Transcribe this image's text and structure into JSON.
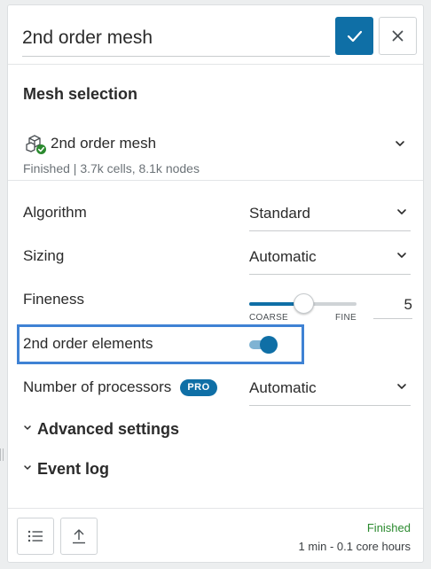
{
  "header": {
    "title_value": "2nd order mesh"
  },
  "mesh_selection": {
    "heading": "Mesh selection",
    "mesh_name": "2nd order mesh",
    "mesh_status": "Finished | 3.7k cells, 8.1k nodes"
  },
  "properties": {
    "algorithm": {
      "label": "Algorithm",
      "value": "Standard"
    },
    "sizing": {
      "label": "Sizing",
      "value": "Automatic"
    },
    "fineness": {
      "label": "Fineness",
      "min_label": "COARSE",
      "max_label": "FINE",
      "value": "5",
      "level": 0.5
    },
    "second_order_elements": {
      "label": "2nd order elements",
      "enabled": true
    },
    "processors": {
      "label": "Number of processors",
      "badge": "PRO",
      "value": "Automatic"
    }
  },
  "sections": {
    "advanced_settings": "Advanced settings",
    "event_log": "Event log"
  },
  "footer": {
    "status": "Finished",
    "summary": "1 min - 0.1 core hours"
  },
  "colors": {
    "accent": "#0f6fa6",
    "highlight_border": "#3f82d4",
    "success": "#2b8a2f"
  },
  "icons": {
    "confirm": "check-icon",
    "close": "close-icon",
    "mesh": "mesh-finished-icon",
    "list": "list-icon",
    "export": "upload-icon"
  }
}
